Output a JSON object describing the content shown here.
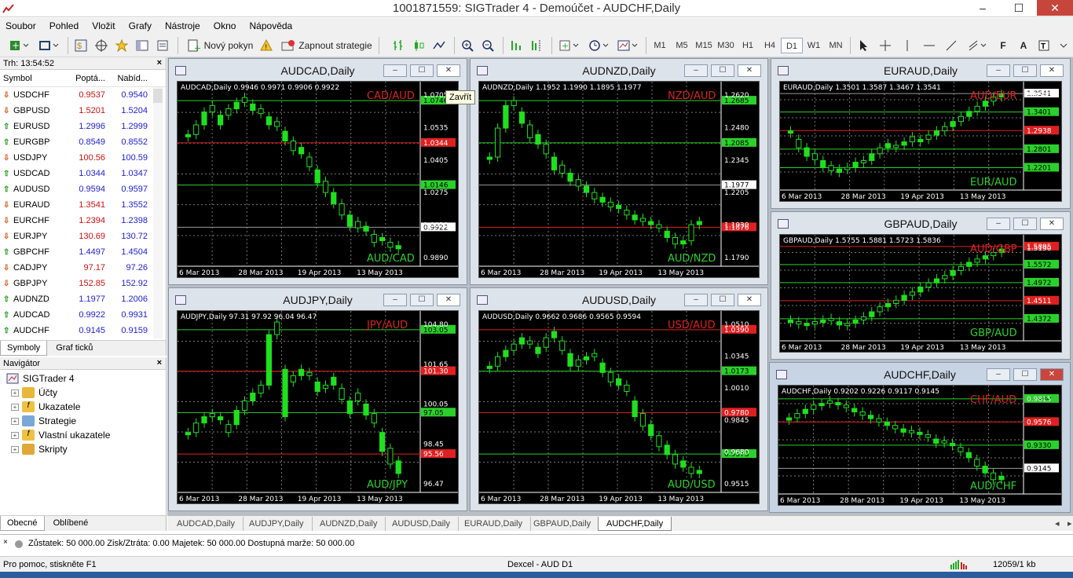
{
  "window": {
    "title": "1001871559: SIGTrader 4 - Demoúčet - AUDCHF,Daily",
    "minimize": "–",
    "maximize": "☐",
    "close": "✕"
  },
  "menu": [
    "Soubor",
    "Pohled",
    "Vložit",
    "Grafy",
    "Nástroje",
    "Okno",
    "Nápověda"
  ],
  "toolbar": {
    "new_order": "Nový pokyn",
    "strategies": "Zapnout strategie",
    "timeframes": [
      "M1",
      "M5",
      "M15",
      "M30",
      "H1",
      "H4",
      "D1",
      "W1",
      "MN"
    ],
    "active_timeframe": "D1"
  },
  "market_watch": {
    "header": "Trh: 13:54:52",
    "columns": [
      "Symbol",
      "Poptá...",
      "Nabíd..."
    ],
    "rows": [
      {
        "symbol": "USDCHF",
        "bid": "0.9537",
        "ask": "0.9540",
        "dir": "down"
      },
      {
        "symbol": "GBPUSD",
        "bid": "1.5201",
        "ask": "1.5204",
        "dir": "down"
      },
      {
        "symbol": "EURUSD",
        "bid": "1.2996",
        "ask": "1.2999",
        "dir": "up"
      },
      {
        "symbol": "EURGBP",
        "bid": "0.8549",
        "ask": "0.8552",
        "dir": "up"
      },
      {
        "symbol": "USDJPY",
        "bid": "100.56",
        "ask": "100.59",
        "dir": "down"
      },
      {
        "symbol": "USDCAD",
        "bid": "1.0344",
        "ask": "1.0347",
        "dir": "up"
      },
      {
        "symbol": "AUDUSD",
        "bid": "0.9594",
        "ask": "0.9597",
        "dir": "up"
      },
      {
        "symbol": "EURAUD",
        "bid": "1.3541",
        "ask": "1.3552",
        "dir": "down"
      },
      {
        "symbol": "EURCHF",
        "bid": "1.2394",
        "ask": "1.2398",
        "dir": "down"
      },
      {
        "symbol": "EURJPY",
        "bid": "130.69",
        "ask": "130.72",
        "dir": "down"
      },
      {
        "symbol": "GBPCHF",
        "bid": "1.4497",
        "ask": "1.4504",
        "dir": "up"
      },
      {
        "symbol": "CADJPY",
        "bid": "97.17",
        "ask": "97.26",
        "dir": "down"
      },
      {
        "symbol": "GBPJPY",
        "bid": "152.85",
        "ask": "152.92",
        "dir": "down"
      },
      {
        "symbol": "AUDNZD",
        "bid": "1.1977",
        "ask": "1.2006",
        "dir": "up"
      },
      {
        "symbol": "AUDCAD",
        "bid": "0.9922",
        "ask": "0.9931",
        "dir": "up"
      },
      {
        "symbol": "AUDCHF",
        "bid": "0.9145",
        "ask": "0.9159",
        "dir": "up"
      }
    ],
    "tabs": [
      "Symboly",
      "Graf ticků"
    ]
  },
  "navigator": {
    "header": "Navigátor",
    "root": "SIGTrader 4",
    "items": [
      "Účty",
      "Ukazatele",
      "Strategie",
      "Vlastní ukazatele",
      "Skripty"
    ],
    "tabs": [
      "Obecné",
      "Oblíbené"
    ]
  },
  "tooltip": "Zavřít",
  "charts": [
    {
      "title": "AUDCAD,Daily",
      "info": "AUDCAD,Daily  0.9946 0.9971 0.9906 0.9922",
      "pair_top": "CAD/AUD",
      "pair_bottom": "AUD/CAD",
      "axis": [
        "1.0705",
        "1.0535",
        "1.0405",
        "1.0275",
        "1.0020",
        "0.9890"
      ],
      "levels": [
        {
          "value": "1.0746",
          "color": "#2ad12a"
        },
        {
          "value": "1.0344",
          "color": "#e02020"
        },
        {
          "value": "1.0146",
          "color": "#2ad12a"
        },
        {
          "value": "0.9922",
          "color": "#ffffff"
        }
      ],
      "dates": [
        "6 Mar 2013",
        "28 Mar 2013",
        "19 Apr 2013",
        "13 May 2013"
      ],
      "series": [
        0.74,
        0.8,
        0.88,
        0.92,
        0.86,
        0.9,
        0.94,
        0.97,
        0.93,
        0.9,
        0.85,
        0.82,
        0.76,
        0.7,
        0.66,
        0.6,
        0.52,
        0.45,
        0.38,
        0.31,
        0.24,
        0.2,
        0.17,
        0.12,
        0.1,
        0.07,
        0.05
      ]
    },
    {
      "title": "AUDNZD,Daily",
      "info": "AUDNZD,Daily  1.1952 1.1990 1.1895 1.1977",
      "pair_top": "NZD/AUD",
      "pair_bottom": "AUD/NZD",
      "axis": [
        "1.2620",
        "1.2480",
        "1.2345",
        "1.2205",
        "1.1930",
        "1.1790"
      ],
      "levels": [
        {
          "value": "1.2685",
          "color": "#2ad12a"
        },
        {
          "value": "1.2085",
          "color": "#2ad12a"
        },
        {
          "value": "1.1977",
          "color": "#ffffff"
        },
        {
          "value": "1.1876",
          "color": "#e02020"
        }
      ],
      "dates": [
        "6 Mar 2013",
        "28 Mar 2013",
        "19 Apr 2013",
        "13 May 2013"
      ],
      "series": [
        0.6,
        0.78,
        0.92,
        0.95,
        0.88,
        0.8,
        0.74,
        0.68,
        0.6,
        0.55,
        0.5,
        0.46,
        0.42,
        0.38,
        0.35,
        0.32,
        0.3,
        0.27,
        0.24,
        0.22,
        0.2,
        0.18,
        0.14,
        0.1,
        0.08,
        0.18,
        0.2
      ]
    },
    {
      "title": "EURAUD,Daily",
      "info": "EURAUD,Daily  1.3501 1.3587 1.3467 1.3541",
      "pair_top": "AUD/EUR",
      "pair_bottom": "EUR/AUD",
      "axis": [
        "1.2590"
      ],
      "levels": [
        {
          "value": "1.3541",
          "color": "#ffffff"
        },
        {
          "value": "1.3401",
          "color": "#2ad12a"
        },
        {
          "value": "1.2938",
          "color": "#e02020"
        },
        {
          "value": "1.2801",
          "color": "#2ad12a"
        },
        {
          "value": "1.2201",
          "color": "#2ad12a"
        }
      ],
      "dates": [
        "6 Mar 2013",
        "28 Mar 2013",
        "19 Apr 2013",
        "13 May 2013"
      ],
      "series": [
        0.55,
        0.45,
        0.35,
        0.28,
        0.2,
        0.14,
        0.1,
        0.12,
        0.18,
        0.2,
        0.28,
        0.35,
        0.4,
        0.38,
        0.42,
        0.48,
        0.45,
        0.5,
        0.55,
        0.6,
        0.66,
        0.72,
        0.78,
        0.84,
        0.9,
        0.95,
        0.98
      ]
    },
    {
      "title": "AUDJPY,Daily",
      "info": "AUDJPY,Daily  97.31 97.92 96.04 96.47",
      "pair_top": "JPY/AUD",
      "pair_bottom": "AUD/JPY",
      "axis": [
        "104.80",
        "101.65",
        "100.05",
        "98.45",
        "96.47"
      ],
      "levels": [
        {
          "value": "103.05",
          "color": "#2ad12a"
        },
        {
          "value": "101.30",
          "color": "#e02020"
        },
        {
          "value": "97.05",
          "color": "#2ad12a"
        },
        {
          "value": "95.56",
          "color": "#e02020"
        }
      ],
      "dates": [
        "6 Mar 2013",
        "28 Mar 2013",
        "19 Apr 2013",
        "13 May 2013"
      ],
      "series": [
        0.3,
        0.36,
        0.4,
        0.42,
        0.4,
        0.35,
        0.44,
        0.5,
        0.55,
        0.6,
        0.92,
        1.0,
        0.7,
        0.66,
        0.7,
        0.68,
        0.62,
        0.6,
        0.65,
        0.58,
        0.5,
        0.55,
        0.48,
        0.42,
        0.3,
        0.2,
        0.12
      ]
    },
    {
      "title": "AUDUSD,Daily",
      "info": "AUDUSD,Daily  0.9662 0.9686 0.9565 0.9594",
      "pair_top": "USD/AUD",
      "pair_bottom": "AUD/USD",
      "axis": [
        "1.0510",
        "1.0345",
        "1.0010",
        "0.9845",
        "0.9680",
        "0.9515"
      ],
      "levels": [
        {
          "value": "1.0390",
          "color": "#e02020"
        },
        {
          "value": "1.0173",
          "color": "#2ad12a"
        },
        {
          "value": "0.9780",
          "color": "#e02020"
        },
        {
          "value": "0.9573",
          "color": "#2ad12a"
        }
      ],
      "dates": [
        "6 Mar 2013",
        "28 Mar 2013",
        "19 Apr 2013",
        "13 May 2013"
      ],
      "series": [
        0.72,
        0.78,
        0.82,
        0.86,
        0.9,
        0.88,
        0.84,
        0.9,
        0.94,
        0.88,
        0.8,
        0.76,
        0.78,
        0.8,
        0.74,
        0.68,
        0.64,
        0.6,
        0.5,
        0.42,
        0.35,
        0.28,
        0.22,
        0.16,
        0.12,
        0.08,
        0.06
      ]
    },
    {
      "title": "GBPAUD,Daily",
      "info": "GBPAUD,Daily  1.5755 1.5881 1.5723 1.5836",
      "pair_top": "AUD/GBP",
      "pair_bottom": "GBP/AUD",
      "axis": [
        "1.5190"
      ],
      "levels": [
        {
          "value": "1.5895",
          "color": "#e02020"
        },
        {
          "value": "1.5572",
          "color": "#2ad12a"
        },
        {
          "value": "1.4972",
          "color": "#2ad12a"
        },
        {
          "value": "1.4511",
          "color": "#e02020"
        },
        {
          "value": "1.4372",
          "color": "#2ad12a"
        }
      ],
      "dates": [
        "6 Mar 2013",
        "28 Mar 2013",
        "19 Apr 2013",
        "13 May 2013"
      ],
      "series": [
        0.1,
        0.08,
        0.06,
        0.08,
        0.1,
        0.12,
        0.08,
        0.06,
        0.1,
        0.14,
        0.2,
        0.26,
        0.3,
        0.34,
        0.4,
        0.44,
        0.5,
        0.55,
        0.6,
        0.64,
        0.7,
        0.75,
        0.8,
        0.84,
        0.88,
        0.92,
        0.96
      ]
    },
    {
      "title": "AUDCHF,Daily",
      "info": "AUDCHF,Daily  0.9202 0.9226 0.9117 0.9145",
      "pair_top": "CHF/AUD",
      "pair_bottom": "AUD/CHF",
      "axis": [
        "0.9815"
      ],
      "levels": [
        {
          "value": "0.9930",
          "color": "#2ad12a"
        },
        {
          "value": "0.9576",
          "color": "#e02020"
        },
        {
          "value": "0.9330",
          "color": "#2ad12a"
        },
        {
          "value": "0.9145",
          "color": "#ffffff"
        }
      ],
      "dates": [
        "6 Mar 2013",
        "28 Mar 2013",
        "19 Apr 2013",
        "13 May 2013"
      ],
      "series": [
        0.75,
        0.8,
        0.85,
        0.9,
        0.92,
        0.95,
        0.93,
        0.9,
        0.86,
        0.82,
        0.78,
        0.74,
        0.7,
        0.66,
        0.62,
        0.6,
        0.58,
        0.55,
        0.5,
        0.48,
        0.45,
        0.4,
        0.34,
        0.26,
        0.18,
        0.1,
        0.06
      ]
    }
  ],
  "window_tabs": [
    "AUDCAD,Daily",
    "AUDJPY,Daily",
    "AUDNZD,Daily",
    "AUDUSD,Daily",
    "EURAUD,Daily",
    "GBPAUD,Daily",
    "AUDCHF,Daily"
  ],
  "active_tab": "AUDCHF,Daily",
  "balance": "Zůstatek: 50 000.00  Zisk/Ztráta: 0.00  Majetek: 50 000.00  Dostupná marže: 50 000.00",
  "status": {
    "help": "Pro pomoc, stiskněte F1",
    "profile": "Dexcel - AUD D1",
    "traffic": "12059/1 kb"
  }
}
